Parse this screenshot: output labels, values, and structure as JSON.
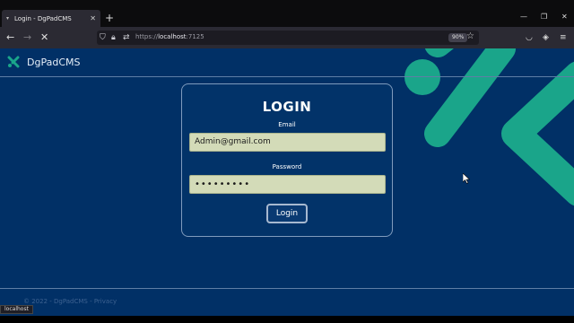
{
  "browser": {
    "tab_title": "Login - DgPadCMS",
    "url_host": "https://",
    "url_domain": "localhost",
    "url_port": ":7125",
    "zoom": "90%",
    "status_text": "localhost"
  },
  "app": {
    "brand": "DgPadCMS",
    "footer": "© 2022 - DgPadCMS - Privacy",
    "accent_color": "#1aa58a",
    "background_color": "#013066"
  },
  "login": {
    "title": "LOGIN",
    "email_label": "Email",
    "email_value": "Admin@gmail.com",
    "password_label": "Password",
    "password_value": "•••••••••",
    "button_label": "Login"
  }
}
